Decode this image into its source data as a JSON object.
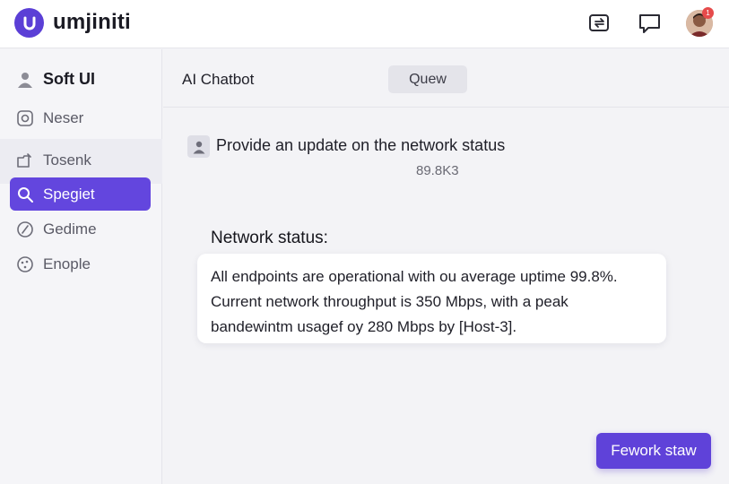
{
  "app": {
    "name": "umjiniti"
  },
  "colors": {
    "accent": "#5f42d9",
    "badge": "#e64b4b"
  },
  "topbar": {
    "icons": [
      "transfer-icon",
      "chat-icon"
    ],
    "notification_count": "1"
  },
  "sidebar": {
    "items": [
      {
        "label": "Soft UI",
        "icon": "user-icon"
      },
      {
        "label": "Neser",
        "icon": "camera-icon"
      },
      {
        "label": "Tosenk",
        "icon": "folder-icon"
      },
      {
        "label": "Spegiet",
        "icon": "search-icon"
      },
      {
        "label": "Gedime",
        "icon": "compass-icon"
      },
      {
        "label": "Enople",
        "icon": "palette-icon"
      }
    ]
  },
  "main": {
    "title": "AI Chatbot",
    "queue_label": "Quew",
    "user_message": "Provide an update on the network status",
    "user_meta": "89.8K3",
    "response_title": "Network status:",
    "response_lines": [
      "All endpoints are operational with ou average uptime 99.8%.",
      "Current network throughput is 350 Mbps, with a peak",
      "bandewintm usagef oy 280 Mbps by [Host-3]."
    ],
    "action_label": "Fework staw"
  }
}
